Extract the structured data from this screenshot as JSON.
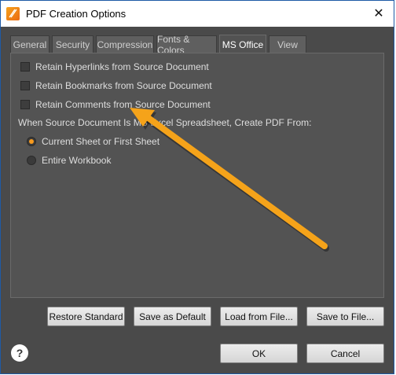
{
  "window": {
    "title": "PDF Creation Options",
    "close_symbol": "✕"
  },
  "tabs": [
    {
      "label": "General",
      "active": false
    },
    {
      "label": "Security",
      "active": false
    },
    {
      "label": "Compression",
      "active": false
    },
    {
      "label": "Fonts & Colors",
      "active": false
    },
    {
      "label": "MS Office",
      "active": true
    },
    {
      "label": "View",
      "active": false
    }
  ],
  "options": {
    "retain_hyperlinks": {
      "label": "Retain Hyperlinks from Source Document",
      "checked": false
    },
    "retain_bookmarks": {
      "label": "Retain Bookmarks from Source Document",
      "checked": false
    },
    "retain_comments": {
      "label": "Retain Comments from Source Document",
      "checked": false
    }
  },
  "spreadsheet": {
    "label": "When Source Document Is MS Excel Spreadsheet, Create PDF From:",
    "options": [
      {
        "label": "Current Sheet or First Sheet",
        "selected": true
      },
      {
        "label": "Entire Workbook",
        "selected": false
      }
    ]
  },
  "buttons": {
    "restore_standard": "Restore Standard",
    "save_as_default": "Save as Default",
    "load_from_file": "Load from File...",
    "save_to_file": "Save to File...",
    "ok": "OK",
    "cancel": "Cancel",
    "help": "?"
  },
  "colors": {
    "accent": "#f79a1e",
    "annotation_arrow": "#f5a31a",
    "dialog_background": "#4a4a4a"
  }
}
